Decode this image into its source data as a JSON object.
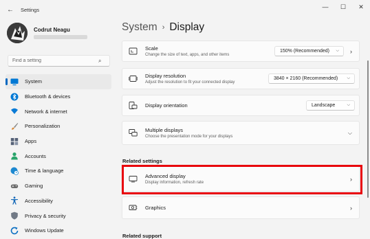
{
  "window": {
    "title": "Settings",
    "controls": {
      "minimize": "—",
      "maximize": "☐",
      "close": "✕"
    }
  },
  "user": {
    "name": "Codrut Neagu"
  },
  "search": {
    "placeholder": "Find a setting"
  },
  "sidebar": {
    "items": [
      {
        "label": "System",
        "icon": "monitor-icon",
        "color": "#0078d4",
        "active": true
      },
      {
        "label": "Bluetooth & devices",
        "icon": "bluetooth-icon",
        "color": "#0078d4"
      },
      {
        "label": "Network & internet",
        "icon": "wifi-icon",
        "color": "#0a7bd6"
      },
      {
        "label": "Personalization",
        "icon": "brush-icon",
        "color": "#d88a3a"
      },
      {
        "label": "Apps",
        "icon": "apps-icon",
        "color": "#566278"
      },
      {
        "label": "Accounts",
        "icon": "person-icon",
        "color": "#2aa46b"
      },
      {
        "label": "Time & language",
        "icon": "globe-clock-icon",
        "color": "#1d88d0"
      },
      {
        "label": "Gaming",
        "icon": "gamepad-icon",
        "color": "#6a6a6a"
      },
      {
        "label": "Accessibility",
        "icon": "accessibility-icon",
        "color": "#1569b8"
      },
      {
        "label": "Privacy & security",
        "icon": "shield-icon",
        "color": "#717a86"
      },
      {
        "label": "Windows Update",
        "icon": "update-icon",
        "color": "#0a6fc2"
      }
    ]
  },
  "breadcrumb": {
    "parent": "System",
    "separator": "›",
    "current": "Display"
  },
  "settings": {
    "scale": {
      "title": "Scale",
      "subtitle": "Change the size of text, apps, and other items",
      "value": "150% (Recommended)"
    },
    "resolution": {
      "title": "Display resolution",
      "subtitle": "Adjust the resolution to fit your connected display",
      "value": "3840 × 2160 (Recommended)"
    },
    "orientation": {
      "title": "Display orientation",
      "value": "Landscape"
    },
    "multiple": {
      "title": "Multiple displays",
      "subtitle": "Choose the presentation mode for your displays"
    }
  },
  "related": {
    "heading": "Related settings",
    "advanced": {
      "title": "Advanced display",
      "subtitle": "Display information, refresh rate"
    },
    "graphics": {
      "title": "Graphics"
    }
  },
  "support": {
    "heading": "Related support"
  },
  "accent": "#0067c0",
  "highlight_color": "#e8000b"
}
